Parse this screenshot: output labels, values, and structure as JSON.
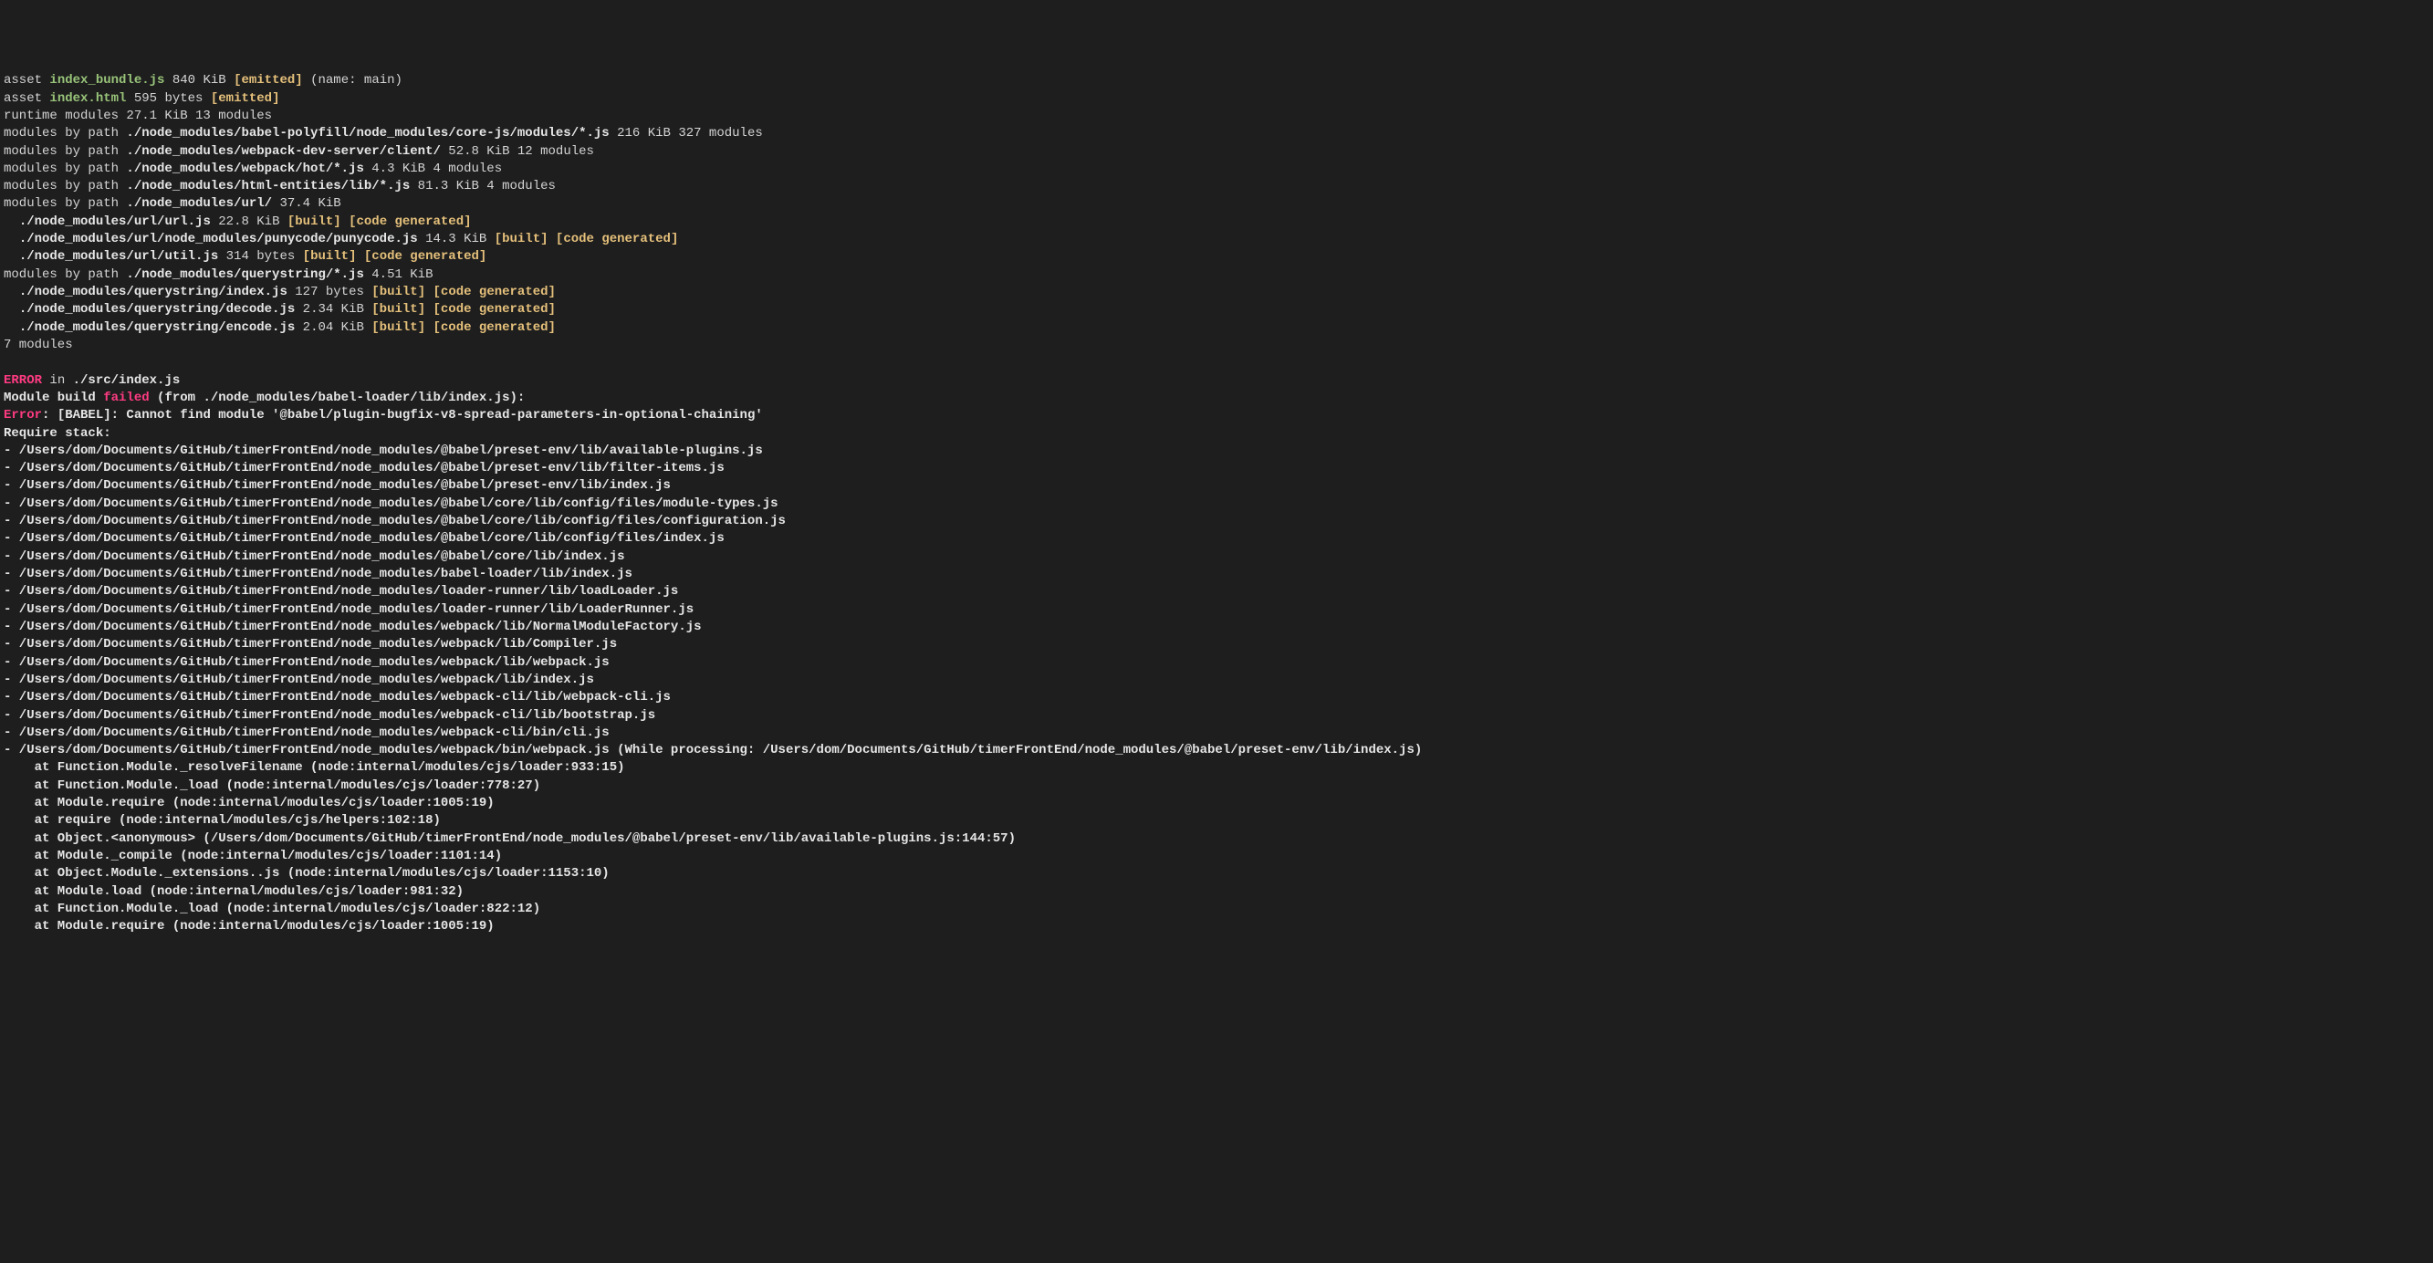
{
  "assets": [
    {
      "prefix": "asset ",
      "name": "index_bundle.js",
      "size": " 840 KiB ",
      "emitted": "[emitted]",
      "extra": " (name: main)"
    },
    {
      "prefix": "asset ",
      "name": "index.html",
      "size": " 595 bytes ",
      "emitted": "[emitted]",
      "extra": ""
    }
  ],
  "runtime": "runtime modules 27.1 KiB 13 modules",
  "mod_prefix": "modules by path ",
  "mod_groups": [
    {
      "path": "./node_modules/babel-polyfill/node_modules/core-js/modules/*.js",
      "size": " 216 KiB 327 modules"
    },
    {
      "path": "./node_modules/webpack-dev-server/client/",
      "size": " 52.8 KiB 12 modules"
    },
    {
      "path": "./node_modules/webpack/hot/*.js",
      "size": " 4.3 KiB 4 modules"
    },
    {
      "path": "./node_modules/html-entities/lib/*.js",
      "size": " 81.3 KiB 4 modules"
    }
  ],
  "url_group": {
    "path": "./node_modules/url/",
    "size": " 37.4 KiB",
    "items": [
      {
        "path": "./node_modules/url/url.js",
        "size": " 22.8 KiB "
      },
      {
        "path": "./node_modules/url/node_modules/punycode/punycode.js",
        "size": " 14.3 KiB "
      },
      {
        "path": "./node_modules/url/util.js",
        "size": " 314 bytes "
      }
    ]
  },
  "qs_group": {
    "path": "./node_modules/querystring/*.js",
    "size": " 4.51 KiB",
    "items": [
      {
        "path": "./node_modules/querystring/index.js",
        "size": " 127 bytes "
      },
      {
        "path": "./node_modules/querystring/decode.js",
        "size": " 2.34 KiB "
      },
      {
        "path": "./node_modules/querystring/encode.js",
        "size": " 2.04 KiB "
      }
    ]
  },
  "built": "[built]",
  "codegen": "[code generated]",
  "seven_modules": "7 modules",
  "error_line": {
    "err": "ERROR",
    "mid": " in ",
    "file": "./src/index.js"
  },
  "fail_line": {
    "a": "Module build ",
    "b": "failed",
    "c": " (from ./node_modules/babel-loader/lib/index.js):"
  },
  "babel_error": {
    "a": "Error",
    "b": ": [BABEL]: Cannot find module '@babel/plugin-bugfix-v8-spread-parameters-in-optional-chaining'"
  },
  "require_stack": "Require stack:",
  "stack": [
    "- /Users/dom/Documents/GitHub/timerFrontEnd/node_modules/@babel/preset-env/lib/available-plugins.js",
    "- /Users/dom/Documents/GitHub/timerFrontEnd/node_modules/@babel/preset-env/lib/filter-items.js",
    "- /Users/dom/Documents/GitHub/timerFrontEnd/node_modules/@babel/preset-env/lib/index.js",
    "- /Users/dom/Documents/GitHub/timerFrontEnd/node_modules/@babel/core/lib/config/files/module-types.js",
    "- /Users/dom/Documents/GitHub/timerFrontEnd/node_modules/@babel/core/lib/config/files/configuration.js",
    "- /Users/dom/Documents/GitHub/timerFrontEnd/node_modules/@babel/core/lib/config/files/index.js",
    "- /Users/dom/Documents/GitHub/timerFrontEnd/node_modules/@babel/core/lib/index.js",
    "- /Users/dom/Documents/GitHub/timerFrontEnd/node_modules/babel-loader/lib/index.js",
    "- /Users/dom/Documents/GitHub/timerFrontEnd/node_modules/loader-runner/lib/loadLoader.js",
    "- /Users/dom/Documents/GitHub/timerFrontEnd/node_modules/loader-runner/lib/LoaderRunner.js",
    "- /Users/dom/Documents/GitHub/timerFrontEnd/node_modules/webpack/lib/NormalModuleFactory.js",
    "- /Users/dom/Documents/GitHub/timerFrontEnd/node_modules/webpack/lib/Compiler.js",
    "- /Users/dom/Documents/GitHub/timerFrontEnd/node_modules/webpack/lib/webpack.js",
    "- /Users/dom/Documents/GitHub/timerFrontEnd/node_modules/webpack/lib/index.js",
    "- /Users/dom/Documents/GitHub/timerFrontEnd/node_modules/webpack-cli/lib/webpack-cli.js",
    "- /Users/dom/Documents/GitHub/timerFrontEnd/node_modules/webpack-cli/lib/bootstrap.js",
    "- /Users/dom/Documents/GitHub/timerFrontEnd/node_modules/webpack-cli/bin/cli.js",
    "- /Users/dom/Documents/GitHub/timerFrontEnd/node_modules/webpack/bin/webpack.js (While processing: /Users/dom/Documents/GitHub/timerFrontEnd/node_modules/@babel/preset-env/lib/index.js)"
  ],
  "at_lines": [
    "    at Function.Module._resolveFilename (node:internal/modules/cjs/loader:933:15)",
    "    at Function.Module._load (node:internal/modules/cjs/loader:778:27)",
    "    at Module.require (node:internal/modules/cjs/loader:1005:19)",
    "    at require (node:internal/modules/cjs/helpers:102:18)",
    "    at Object.<anonymous> (/Users/dom/Documents/GitHub/timerFrontEnd/node_modules/@babel/preset-env/lib/available-plugins.js:144:57)",
    "    at Module._compile (node:internal/modules/cjs/loader:1101:14)",
    "    at Object.Module._extensions..js (node:internal/modules/cjs/loader:1153:10)",
    "    at Module.load (node:internal/modules/cjs/loader:981:32)",
    "    at Function.Module._load (node:internal/modules/cjs/loader:822:12)",
    "    at Module.require (node:internal/modules/cjs/loader:1005:19)"
  ]
}
